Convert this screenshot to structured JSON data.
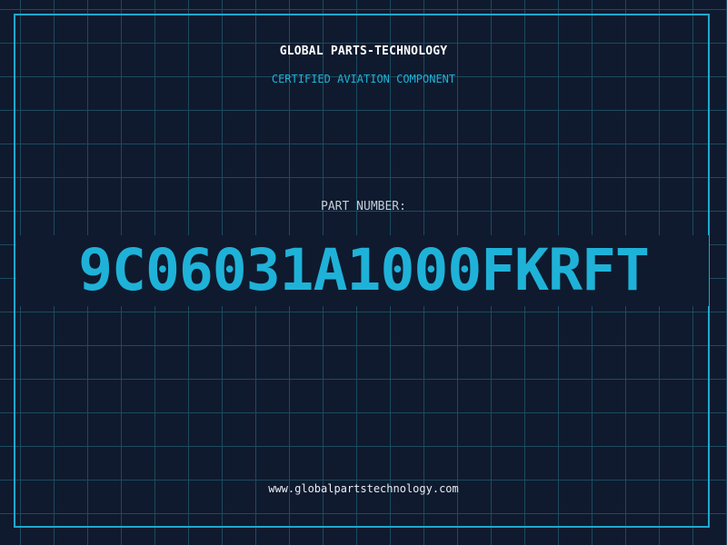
{
  "header": {
    "company": "GLOBAL PARTS-TECHNOLOGY",
    "subtitle": "CERTIFIED AVIATION COMPONENT"
  },
  "part": {
    "label": "PART NUMBER:",
    "number": "9C06031A1000FKRFT"
  },
  "footer": {
    "website": "www.globalpartstechnology.com"
  },
  "colors": {
    "background": "#0f1a2e",
    "grid": "#1d4a5e",
    "accent": "#1fb2d8",
    "title": "#ffffff"
  }
}
